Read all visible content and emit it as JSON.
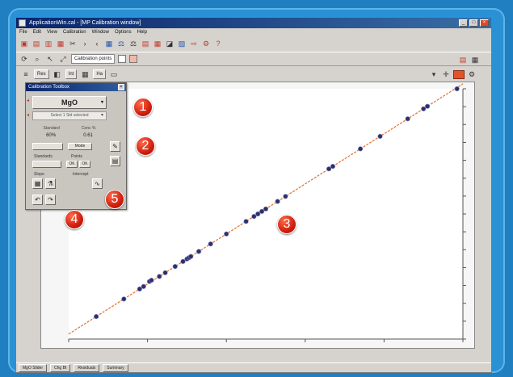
{
  "window": {
    "title": "ApplicationWin.cal - [MP Calibration window]",
    "menu": [
      "File",
      "Edit",
      "View",
      "Calibration",
      "Window",
      "Options",
      "Help"
    ]
  },
  "toolbar2": {
    "field_label": "Calibration points"
  },
  "toolbar3": {
    "tabs": [
      "",
      "Res",
      "Int",
      "Ha"
    ]
  },
  "panel": {
    "title": "Calibration Toolbox",
    "element": "MgO",
    "standard": "Select 1 Std selected",
    "col1_head": "Standard",
    "col2_head": "Conc %",
    "col1_val": "60%",
    "col2_val": "0.61",
    "btn_std": "",
    "btn_mode": "Mode",
    "group_a": "Standards",
    "group_b": "Points",
    "sub_a": "",
    "sub_b": "",
    "btn_c": "OK",
    "btn_d": "OK",
    "group_c": "Slope",
    "group_d": "Intercept"
  },
  "markers": [
    "1",
    "2",
    "3",
    "4",
    "5"
  ],
  "statusbar": {
    "tabs": [
      "MgO Slider",
      "Chg Bt",
      "Residuals",
      "Summary"
    ]
  },
  "colors": {
    "accent_red": "#d11e0e",
    "line": "#e07a3a",
    "points": "#2d2f6a",
    "frame": "#1f7fc0"
  },
  "chart_data": {
    "type": "scatter",
    "title": "",
    "xlabel": "",
    "ylabel": "",
    "series": [
      {
        "values": [
          [
            0.07,
            0.09
          ],
          [
            0.14,
            0.16
          ],
          [
            0.18,
            0.2
          ],
          [
            0.19,
            0.21
          ],
          [
            0.205,
            0.23
          ],
          [
            0.21,
            0.235
          ],
          [
            0.23,
            0.25
          ],
          [
            0.245,
            0.265
          ],
          [
            0.27,
            0.29
          ],
          [
            0.29,
            0.31
          ],
          [
            0.3,
            0.32
          ],
          [
            0.305,
            0.325
          ],
          [
            0.31,
            0.33
          ],
          [
            0.33,
            0.35
          ],
          [
            0.36,
            0.38
          ],
          [
            0.4,
            0.42
          ],
          [
            0.45,
            0.47
          ],
          [
            0.47,
            0.49
          ],
          [
            0.48,
            0.5
          ],
          [
            0.49,
            0.51
          ],
          [
            0.5,
            0.52
          ],
          [
            0.53,
            0.55
          ],
          [
            0.55,
            0.57
          ],
          [
            0.66,
            0.68
          ],
          [
            0.67,
            0.69
          ],
          [
            0.74,
            0.76
          ],
          [
            0.79,
            0.81
          ],
          [
            0.86,
            0.88
          ],
          [
            0.9,
            0.92
          ],
          [
            0.91,
            0.93
          ],
          [
            0.985,
            1.0
          ]
        ]
      }
    ],
    "xlim": [
      0,
      1
    ],
    "ylim": [
      0,
      1
    ],
    "fit_line": [
      [
        0,
        0.02
      ],
      [
        1,
        1.02
      ]
    ],
    "grid": false
  }
}
